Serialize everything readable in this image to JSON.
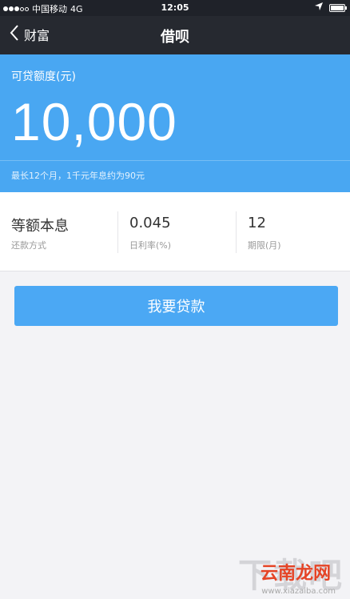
{
  "status_bar": {
    "carrier": "中国移动",
    "network": "4G",
    "time": "12:05"
  },
  "nav": {
    "back_label": "财富",
    "title": "借呗"
  },
  "hero": {
    "label": "可贷额度(元)",
    "amount": "10,000",
    "note": "最长12个月，1千元年息约为90元"
  },
  "info": [
    {
      "value": "等额本息",
      "caption": "还款方式"
    },
    {
      "value": "0.045",
      "caption": "日利率(%)"
    },
    {
      "value": "12",
      "caption": "期限(月)"
    }
  ],
  "action": {
    "button_label": "我要贷款"
  },
  "watermark": {
    "bg_text": "下载吧",
    "brand": "云南龙网",
    "url": "www.xiazaiba.com"
  },
  "colors": {
    "hero_bg": "#49a7f2",
    "button_bg": "#4ba8f4",
    "nav_bg": "#262930"
  }
}
